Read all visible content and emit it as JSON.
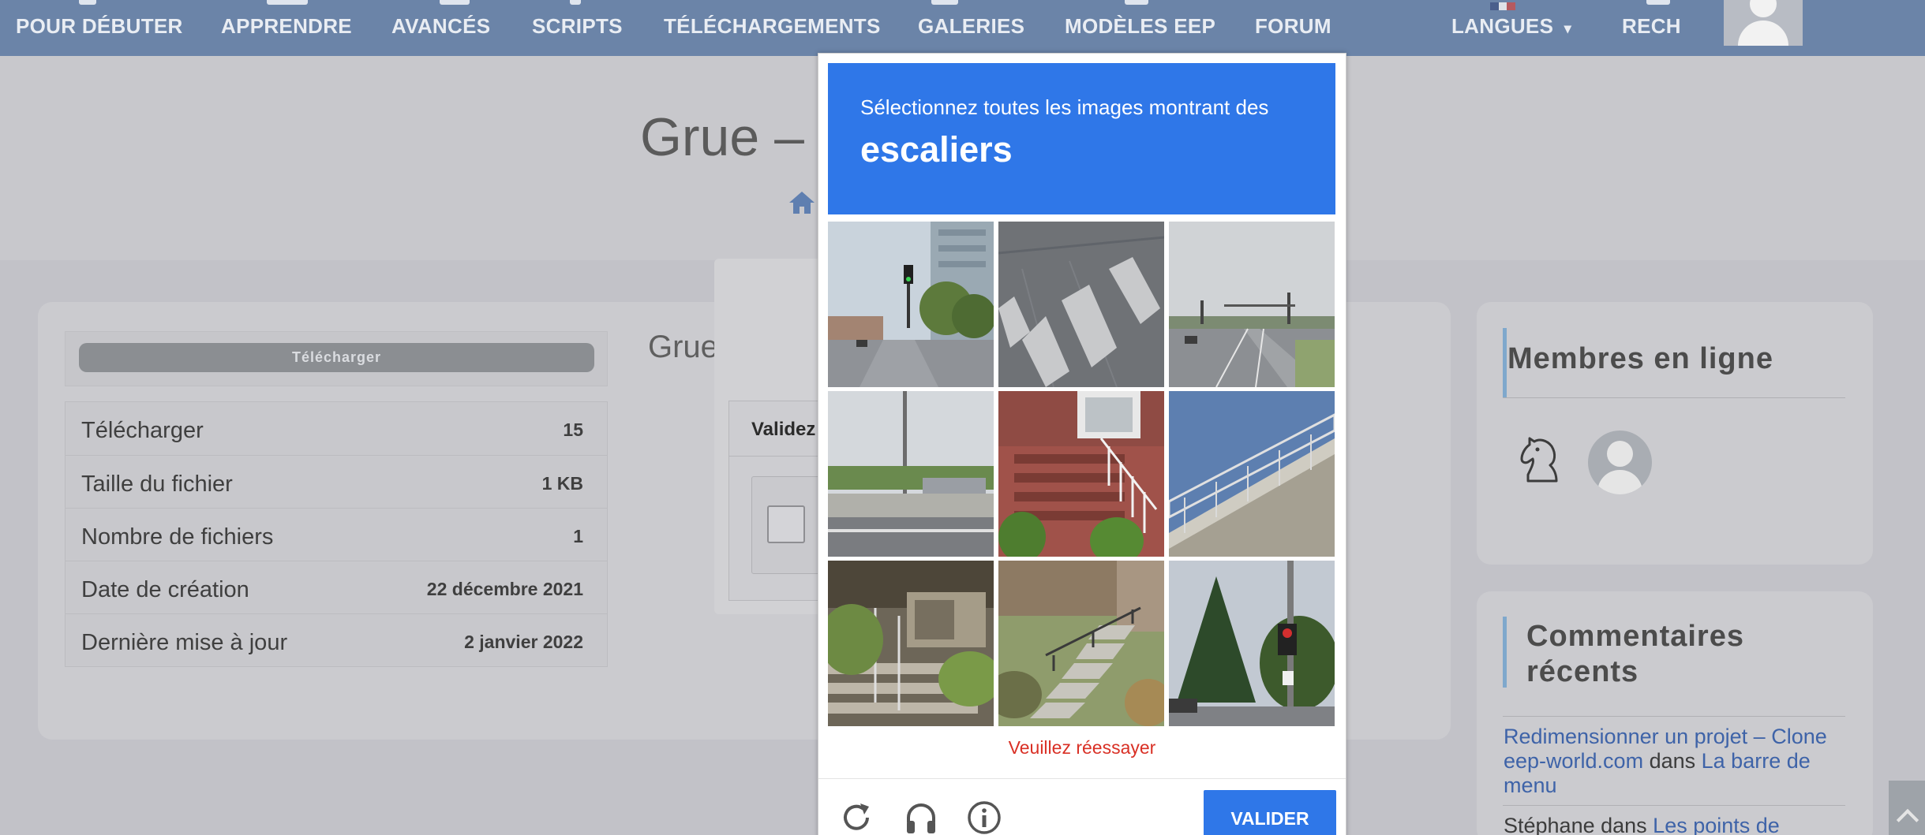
{
  "nav": {
    "items": [
      "POUR DÉBUTER",
      "APPRENDRE",
      "AVANCÉS",
      "SCRIPTS",
      "TÉLÉCHARGEMENTS",
      "GALERIES",
      "MODÈLES EEP",
      "FORUM"
    ],
    "languages": "LANGUES",
    "languages_caret": "▾",
    "search": "RECH"
  },
  "hero": {
    "title": "Grue –"
  },
  "sidebar": {
    "download_button": "Télécharger",
    "stats": [
      {
        "label": "Télécharger",
        "value": "15"
      },
      {
        "label": "Taille du fichier",
        "value": "1 KB"
      },
      {
        "label": "Nombre de fichiers",
        "value": "1"
      },
      {
        "label": "Date de création",
        "value": "22 décembre 2021"
      },
      {
        "label": "Dernière mise à jour",
        "value": "2 janvier 2022"
      }
    ]
  },
  "content": {
    "title_partial": "Grue"
  },
  "under_dialog": {
    "header": "Validez"
  },
  "widgets": {
    "members_title": "Membres en ligne",
    "comments_title_line1": "Commentaires",
    "comments_title_line2": "récents",
    "comments": [
      {
        "link": "Redimensionner un projet – Clone eep-world.com",
        "mid": " dans ",
        "post": "La barre de menu"
      },
      {
        "author": "Stéphane",
        "mid": " dans ",
        "post": "Les points de"
      }
    ]
  },
  "captcha": {
    "prompt": "Sélectionnez toutes les images montrant des",
    "keyword": "escaliers",
    "tiles": [
      {
        "description": "street-with-traffic-light"
      },
      {
        "description": "road-marking-only"
      },
      {
        "description": "highway-intersection"
      },
      {
        "description": "road-with-parking-lot"
      },
      {
        "description": "brick-stairs-with-railing"
      },
      {
        "description": "bridge-overpass"
      },
      {
        "description": "porch-steps"
      },
      {
        "description": "outdoor-stairs-with-railing"
      },
      {
        "description": "trees-and-traffic-light"
      }
    ],
    "error": "Veuillez réessayer",
    "verify_label": "VALIDER",
    "colors": {
      "accent": "#2f77e8",
      "error": "#d93025"
    }
  }
}
